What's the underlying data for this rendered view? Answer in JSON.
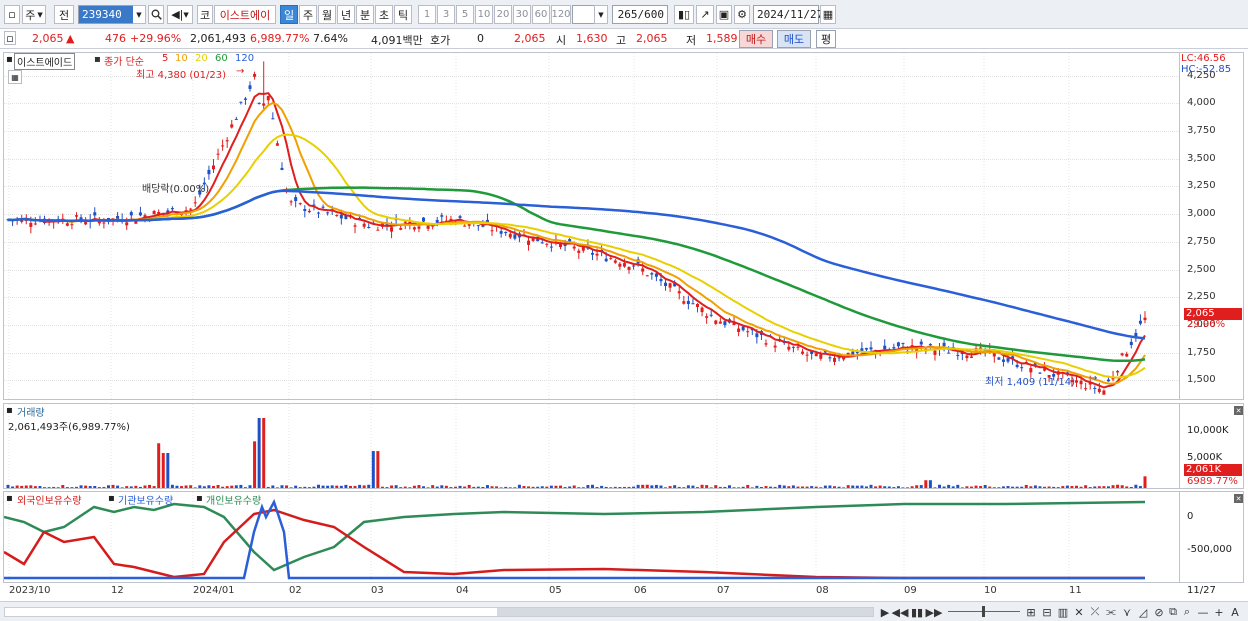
{
  "toolbar": {
    "market_btn": "주",
    "prev_btn": "전",
    "stock_code": "239340",
    "code_type_btn": "코",
    "stock_name": "이스트에이",
    "periods": [
      "일",
      "주",
      "월",
      "년",
      "분",
      "초",
      "틱"
    ],
    "selected_period": "일",
    "intervals": [
      "1",
      "3",
      "5",
      "10",
      "20",
      "30",
      "60",
      "120"
    ],
    "count_value": "265",
    "count_max": "/600",
    "date": "2024/11/27"
  },
  "quote": {
    "price": "2,065",
    "change": "476",
    "change_pct": "+29.96%",
    "volume": "2,061,493",
    "volume_pct": "6,989.77%",
    "turnover": "7.64%",
    "amount": "4,091백만",
    "hoga_label": "호가",
    "hoga_value": "0",
    "hoga_price": "2,065",
    "open_label": "시",
    "open": "1,630",
    "high_label": "고",
    "high": "2,065",
    "low_label": "저",
    "low": "1,589",
    "buy_btn": "매수",
    "sell_btn": "매도",
    "eval_btn": "평"
  },
  "price_panel": {
    "stock_label": "이스트에이드",
    "ma_title": "종가 단순",
    "ma_periods": [
      "5",
      "10",
      "20",
      "60",
      "120"
    ],
    "ma_colors": [
      "#e01e1e",
      "#f0a000",
      "#e8d000",
      "#1f9a3a",
      "#2a5fd8"
    ],
    "high_note": "최고 4,380 (01/23)",
    "low_note": "최저 1,409 (11/14)",
    "ex_rights_note": "배당락(0.00%)",
    "lc_label": "LC:46.56",
    "hc_label": "HC:-52.85",
    "y_ticks": [
      "4,250",
      "4,000",
      "3,750",
      "3,500",
      "3,250",
      "3,000",
      "2,750",
      "2,500",
      "2,250",
      "2,000",
      "1,750",
      "1,500"
    ],
    "last_price_tag": "2,065",
    "last_pct_tag": "29.96%"
  },
  "volume_panel": {
    "title": "거래량",
    "value_label": "2,061,493주(6,989.77%)",
    "y_ticks": [
      "10,000K",
      "5,000K"
    ],
    "last_tag": "2,061K",
    "last_pct_tag": "6989.77%"
  },
  "holdings_panel": {
    "series_labels": [
      "외국인보유수량",
      "기관보유수량",
      "개인보유수량"
    ],
    "series_colors": [
      "#d41c1c",
      "#2a5fd8",
      "#2e8b57"
    ],
    "y_ticks": [
      "0",
      "-500,000"
    ]
  },
  "x_axis": {
    "labels": [
      "2023/10",
      "12",
      "2024/01",
      "02",
      "03",
      "04",
      "05",
      "06",
      "07",
      "08",
      "09",
      "10",
      "11"
    ],
    "last_date": "11/27"
  },
  "chart_data": {
    "type": "candlestick",
    "title": "이스트에이드",
    "y_range": [
      1400,
      4400
    ],
    "approx_close_path": [
      {
        "x": "2023/10",
        "y": 2950
      },
      {
        "x": "2023/11",
        "y": 2950
      },
      {
        "x": "2023/12",
        "y": 2950
      },
      {
        "x": "2024/01",
        "y": 3050
      },
      {
        "x": "2024/01/23",
        "y": 4380
      },
      {
        "x": "2024/02",
        "y": 3100
      },
      {
        "x": "2024/03",
        "y": 2900
      },
      {
        "x": "2024/04",
        "y": 2950
      },
      {
        "x": "2024/05",
        "y": 2750
      },
      {
        "x": "2024/06",
        "y": 2550
      },
      {
        "x": "2024/07",
        "y": 2050
      },
      {
        "x": "2024/08",
        "y": 1700
      },
      {
        "x": "2024/09",
        "y": 1800
      },
      {
        "x": "2024/10",
        "y": 1750
      },
      {
        "x": "2024/11/14",
        "y": 1409
      },
      {
        "x": "2024/11/27",
        "y": 2065
      }
    ]
  }
}
